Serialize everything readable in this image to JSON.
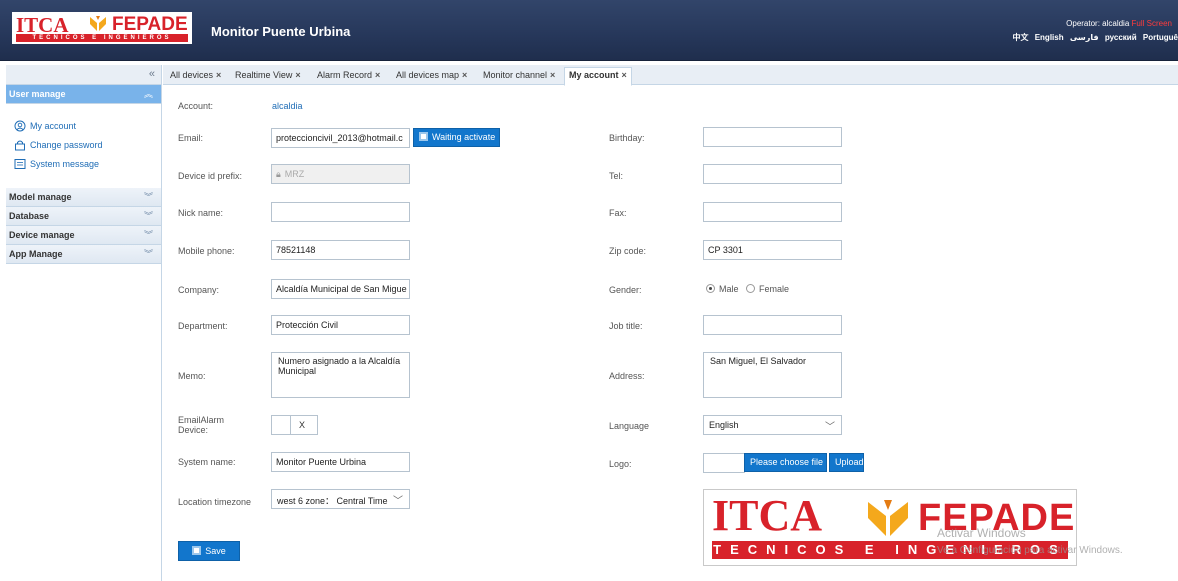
{
  "header": {
    "logo_text_1": "ITCA",
    "logo_text_2": "FEPADE",
    "logo_strip": "TECNICOS E INGENIEROS",
    "app_title": "Monitor Puente Urbina",
    "operator_label": "Operator: alcaldia",
    "operator_extra": "Full Screen",
    "languages": [
      "中文",
      "English",
      "فارسی",
      "русский",
      "Portuguê"
    ]
  },
  "sidebar": {
    "sections": [
      {
        "label": "User manage",
        "active": true
      },
      {
        "label": "Model manage"
      },
      {
        "label": "Database"
      },
      {
        "label": "Device manage"
      },
      {
        "label": "App Manage"
      }
    ],
    "user_items": [
      {
        "label": "My account",
        "icon": "user-circle-icon"
      },
      {
        "label": "Change password",
        "icon": "lock-icon"
      },
      {
        "label": "System message",
        "icon": "message-icon"
      }
    ]
  },
  "tabs": [
    {
      "label": "All devices"
    },
    {
      "label": "Realtime View"
    },
    {
      "label": "Alarm Record"
    },
    {
      "label": "All devices map"
    },
    {
      "label": "Monitor channel"
    },
    {
      "label": "My account",
      "selected": true
    }
  ],
  "form": {
    "account_label": "Account:",
    "account_value": "alcaldia",
    "email_label": "Email:",
    "email_value": "proteccioncivil_2013@hotmail.c",
    "waiting_btn": "Waiting activate",
    "birthday_label": "Birthday:",
    "birthday_value": "",
    "prefix_label": "Device id prefix:",
    "prefix_value": "MRZ",
    "tel_label": "Tel:",
    "tel_value": "",
    "nick_label": "Nick name:",
    "nick_value": "",
    "fax_label": "Fax:",
    "fax_value": "",
    "mobile_label": "Mobile phone:",
    "mobile_value": "78521148",
    "zip_label": "Zip code:",
    "zip_value": "CP 3301",
    "company_label": "Company:",
    "company_value": "Alcaldía Municipal de San Migue",
    "gender_label": "Gender:",
    "gender_male": "Male",
    "gender_female": "Female",
    "department_label": "Department:",
    "department_value": "Protección Civil",
    "jobtitle_label": "Job title:",
    "jobtitle_value": "",
    "memo_label": "Memo:",
    "memo_value": "Numero asignado a la Alcaldía Municipal",
    "address_label": "Address:",
    "address_value": "San Miguel, El Salvador",
    "emailalarm_label_1": "EmailAlarm",
    "emailalarm_label_2": "Device:",
    "emailalarm_x": "X",
    "language_label": "Language",
    "language_value": "English",
    "sysname_label": "System name:",
    "sysname_value": "Monitor Puente Urbina",
    "logo_label": "Logo:",
    "choose_file_btn": "Please choose file",
    "upload_btn": "Upload",
    "timezone_label": "Location timezone",
    "timezone_value": "west 6 zone： Central Time",
    "save_btn": "Save"
  },
  "watermark": {
    "line1": "Activar Windows",
    "line2": "Ve a Configuración para activar Windows."
  },
  "colors": {
    "header_bg": "#26375a",
    "accent_blue": "#1276cc",
    "brand_red": "#d8222a",
    "sidebar_active": "#79b3ea"
  }
}
